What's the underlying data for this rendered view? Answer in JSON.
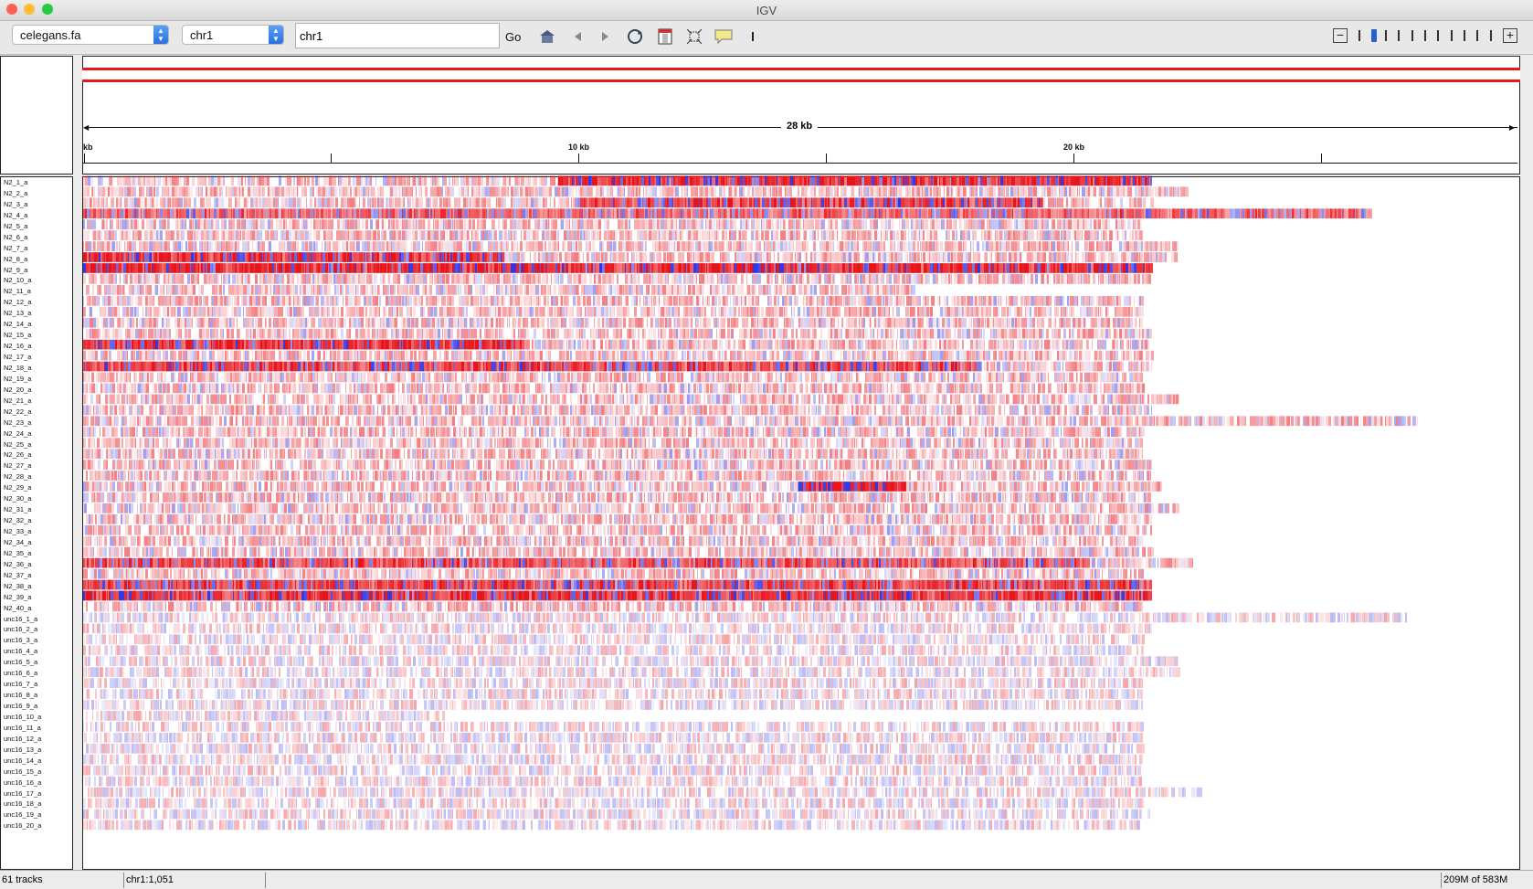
{
  "window": {
    "title": "IGV"
  },
  "toolbar": {
    "genome": "celegans.fa",
    "chromosome": "chr1",
    "locus": "chr1",
    "go_label": "Go"
  },
  "ruler": {
    "span_label": "28 kb",
    "tick_labels": [
      "kb",
      "10 kb",
      "20 kb"
    ]
  },
  "tracks": [
    "N2_1_a",
    "N2_2_a",
    "N2_3_a",
    "N2_4_a",
    "N2_5_a",
    "N2_6_a",
    "N2_7_a",
    "N2_8_a",
    "N2_9_a",
    "N2_10_a",
    "N2_11_a",
    "N2_12_a",
    "N2_13_a",
    "N2_14_a",
    "N2_15_a",
    "N2_16_a",
    "N2_17_a",
    "N2_18_a",
    "N2_19_a",
    "N2_20_a",
    "N2_21_a",
    "N2_22_a",
    "N2_23_a",
    "N2_24_a",
    "N2_25_a",
    "N2_26_a",
    "N2_27_a",
    "N2_28_a",
    "N2_29_a",
    "N2_30_a",
    "N2_31_a",
    "N2_32_a",
    "N2_33_a",
    "N2_34_a",
    "N2_35_a",
    "N2_36_a",
    "N2_37_a",
    "N2_38_a",
    "N2_39_a",
    "N2_40_a",
    "unc16_1_a",
    "unc16_2_a",
    "unc16_3_a",
    "unc16_4_a",
    "unc16_5_a",
    "unc16_6_a",
    "unc16_7_a",
    "unc16_8_a",
    "unc16_9_a",
    "unc16_10_a",
    "unc16_11_a",
    "unc16_12_a",
    "unc16_13_a",
    "unc16_14_a",
    "unc16_15_a",
    "unc16_16_a",
    "unc16_17_a",
    "unc16_18_a",
    "unc16_19_a",
    "unc16_20_a"
  ],
  "status": {
    "track_count": "61 tracks",
    "position": "chr1:1,051",
    "memory": "209M of 583M"
  },
  "colors": {
    "high": "#e8141c",
    "low": "#2020e0",
    "ideogram": "#e41a1c"
  }
}
